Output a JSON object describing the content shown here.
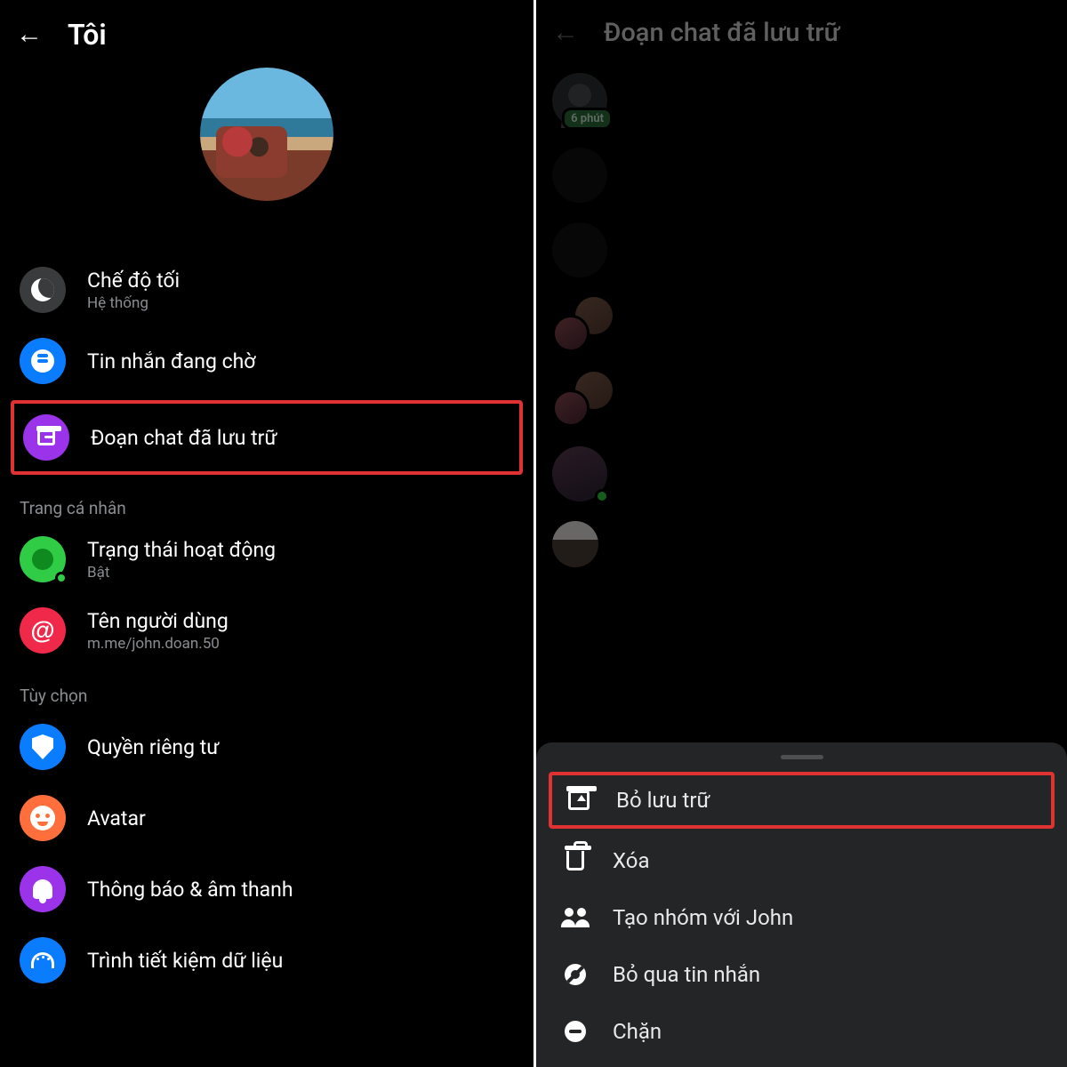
{
  "left": {
    "back_icon": "←",
    "title": "Tôi",
    "items": {
      "dark_mode": {
        "label": "Chế độ tối",
        "sub": "Hệ thống"
      },
      "pending": {
        "label": "Tin nhắn đang chờ"
      },
      "archived": {
        "label": "Đoạn chat đã lưu trữ"
      }
    },
    "section_profile": "Trang cá nhân",
    "profile_items": {
      "active": {
        "label": "Trạng thái hoạt động",
        "sub": "Bật"
      },
      "username": {
        "label": "Tên người dùng",
        "sub": "m.me/john.doan.50"
      }
    },
    "section_options": "Tùy chọn",
    "option_items": {
      "privacy": {
        "label": "Quyền riêng tư"
      },
      "avatar": {
        "label": "Avatar"
      },
      "notif": {
        "label": "Thông báo & âm thanh"
      },
      "saver": {
        "label": "Trình tiết kiệm dữ liệu"
      }
    }
  },
  "right": {
    "back_icon": "←",
    "title": "Đoạn chat đã lưu trữ",
    "time_badge": "6 phút",
    "sheet": {
      "unarchive": "Bỏ lưu trữ",
      "delete": "Xóa",
      "group": "Tạo nhóm với John",
      "mute": "Bỏ qua tin nhắn",
      "block": "Chặn"
    }
  }
}
